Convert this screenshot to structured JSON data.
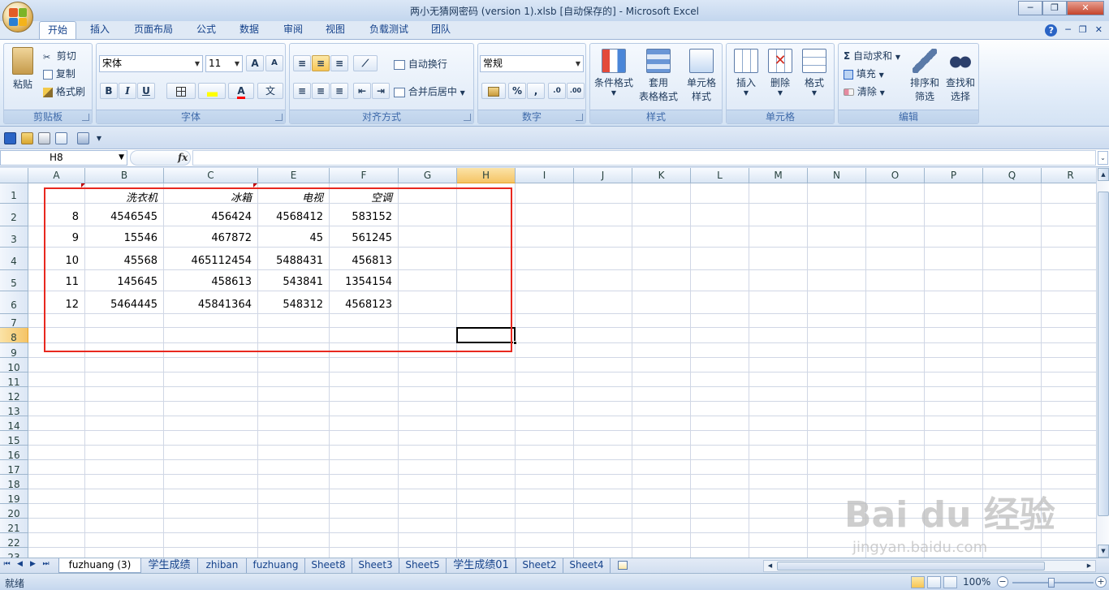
{
  "window": {
    "title": "两小无猜网密码 (version 1).xlsb [自动保存的] - Microsoft Excel",
    "minimize": "─",
    "restore": "❐",
    "close": "✕"
  },
  "tabs": [
    {
      "label": "开始",
      "active": true
    },
    {
      "label": "插入"
    },
    {
      "label": "页面布局"
    },
    {
      "label": "公式"
    },
    {
      "label": "数据"
    },
    {
      "label": "审阅"
    },
    {
      "label": "视图"
    },
    {
      "label": "负载测试"
    },
    {
      "label": "团队"
    }
  ],
  "tab_right": {
    "help": "?",
    "min": "─",
    "restore": "❐",
    "close": "✕"
  },
  "ribbon": {
    "clipboard": {
      "label": "剪贴板",
      "paste": "粘贴",
      "cut": "剪切",
      "copy": "复制",
      "format_painter": "格式刷"
    },
    "font": {
      "label": "字体",
      "font_name": "宋体",
      "font_size": "11",
      "grow": "A",
      "shrink": "A",
      "bold": "B",
      "italic": "I",
      "underline": "U",
      "font_color": "A",
      "phonetic": "文"
    },
    "alignment": {
      "label": "对齐方式",
      "wrap_text": "自动换行",
      "merge_center": "合并后居中"
    },
    "number": {
      "label": "数字",
      "format": "常规",
      "percent": "%",
      "comma": ",",
      "inc_dec": ".0",
      "dec_dec": ".00"
    },
    "styles": {
      "label": "样式",
      "conditional": "条件格式",
      "table_fmt_1": "套用",
      "table_fmt_2": "表格格式",
      "cell_style_1": "单元格",
      "cell_style_2": "样式"
    },
    "cells": {
      "label": "单元格",
      "insert": "插入",
      "delete": "删除",
      "format": "格式"
    },
    "editing": {
      "label": "编辑",
      "autosum": "自动求和",
      "fill": "填充",
      "clear": "清除",
      "sort_1": "排序和",
      "sort_2": "筛选",
      "find_1": "查找和",
      "find_2": "选择"
    }
  },
  "formula_bar": {
    "name_box": "H8",
    "fx": "fx",
    "content": ""
  },
  "sheet": {
    "columns": [
      "A",
      "B",
      "C",
      "E",
      "F",
      "G",
      "H",
      "I",
      "J",
      "K",
      "L",
      "M",
      "N",
      "O",
      "P",
      "Q",
      "R"
    ],
    "selected_column": "H",
    "rows": [
      "1",
      "2",
      "3",
      "4",
      "5",
      "6",
      "7",
      "8",
      "9",
      "10",
      "11",
      "12",
      "13",
      "14",
      "15",
      "16",
      "17",
      "18",
      "19",
      "20",
      "21",
      "22",
      "23"
    ],
    "selected_row": "8",
    "header_row": [
      "",
      "洗衣机",
      "冰箱",
      "电视",
      "空调"
    ],
    "data_rows": [
      [
        "8",
        "4546545",
        "456424",
        "4568412",
        "583152"
      ],
      [
        "9",
        "15546",
        "467872",
        "45",
        "561245"
      ],
      [
        "10",
        "45568",
        "465112454",
        "5488431",
        "456813"
      ],
      [
        "11",
        "145645",
        "458613",
        "543841",
        "1354154"
      ],
      [
        "12",
        "5464445",
        "45841364",
        "548312",
        "4568123"
      ]
    ]
  },
  "sheet_tabs": [
    {
      "label": "fuzhuang (3)",
      "active": true
    },
    {
      "label": "学生成绩"
    },
    {
      "label": "zhiban"
    },
    {
      "label": "fuzhuang"
    },
    {
      "label": "Sheet8"
    },
    {
      "label": "Sheet3"
    },
    {
      "label": "Sheet5"
    },
    {
      "label": "学生成绩01"
    },
    {
      "label": "Sheet2"
    },
    {
      "label": "Sheet4"
    }
  ],
  "status": {
    "ready": "就绪",
    "zoom": "100%",
    "zoom_minus": "−",
    "zoom_plus": "+"
  },
  "watermark": {
    "brand": "Bai du 经验",
    "url": "jingyan.baidu.com"
  },
  "colors": {
    "accent_red": "#e8281f",
    "selection_orange": "#f5c465",
    "ribbon_blue": "#15428b"
  }
}
